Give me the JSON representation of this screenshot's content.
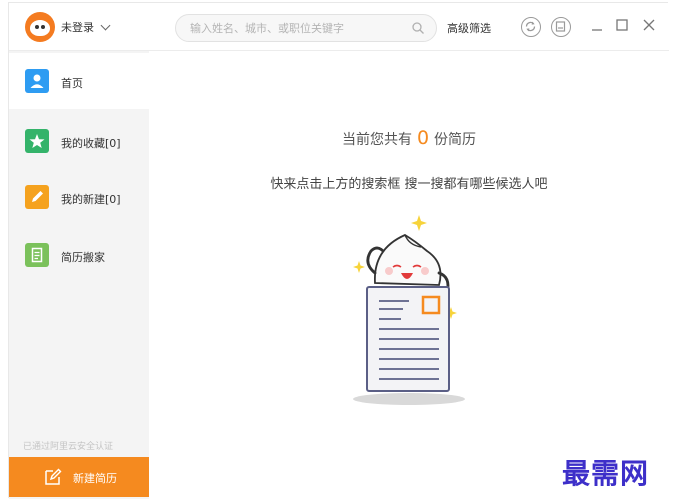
{
  "titlebar": {
    "user_label": "未登录",
    "search_placeholder": "输入姓名、城市、或职位关键字",
    "advanced_filter": "高级筛选",
    "icons": [
      "sync-icon",
      "save-icon",
      "minimize-icon",
      "maximize-icon",
      "close-icon"
    ]
  },
  "sidebar": {
    "items": [
      {
        "label": "首页",
        "icon": "person-icon",
        "color": "#2e9cf2"
      },
      {
        "label": "我的收藏[0]",
        "icon": "star-icon",
        "color": "#34b36a"
      },
      {
        "label": "我的新建[0]",
        "icon": "pencil-icon",
        "color": "#f5a21e"
      },
      {
        "label": "简历搬家",
        "icon": "document-icon",
        "color": "#7bc15b"
      }
    ],
    "verify_text": "已通过阿里云安全认证",
    "new_resume_button": "新建简历"
  },
  "main": {
    "count_prefix": "当前您共有",
    "count_value": "0",
    "count_suffix": "份简历",
    "hint": "快来点击上方的搜索框  搜一搜都有哪些候选人吧"
  },
  "watermark": "最需网",
  "colors": {
    "accent": "#f58a1f",
    "sidebar_bg": "#f4f4f4",
    "watermark": "#3d2fc9"
  }
}
